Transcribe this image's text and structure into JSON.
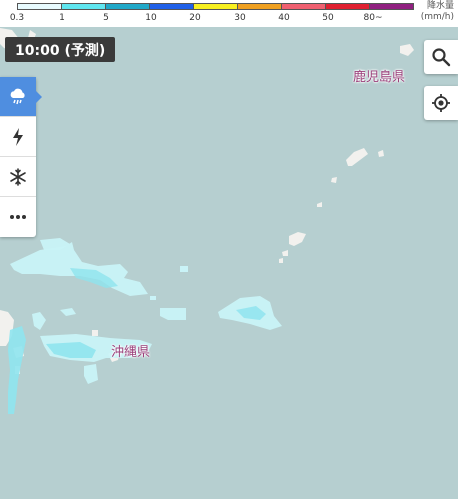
{
  "legend": {
    "title": "降水量",
    "unit": "(mm/h)",
    "ticks": [
      "0.3",
      "1",
      "5",
      "10",
      "20",
      "30",
      "40",
      "50",
      "80~"
    ],
    "colors": [
      "#e8fbff",
      "#5fe6f0",
      "#20a8c8",
      "#2060e8",
      "#f8f020",
      "#f0a020",
      "#f06070",
      "#e02030",
      "#902080"
    ]
  },
  "time_badge": {
    "label": "10:00 (予測)"
  },
  "layers": [
    {
      "name": "rain",
      "icon": "rain-cloud-icon",
      "active": true
    },
    {
      "name": "lightning",
      "icon": "lightning-icon",
      "active": false
    },
    {
      "name": "snow",
      "icon": "snowflake-icon",
      "active": false
    },
    {
      "name": "more",
      "icon": "more-dots-icon",
      "active": false
    }
  ],
  "labels": {
    "kagoshima": "鹿児島県",
    "okinawa": "沖縄県"
  },
  "colors": {
    "sea": "#b6cfd0",
    "land": "#f2f1ee",
    "rain_light": "#c9f3f7",
    "rain_mid": "#8fe4ee",
    "accent": "#4f8ee0"
  }
}
